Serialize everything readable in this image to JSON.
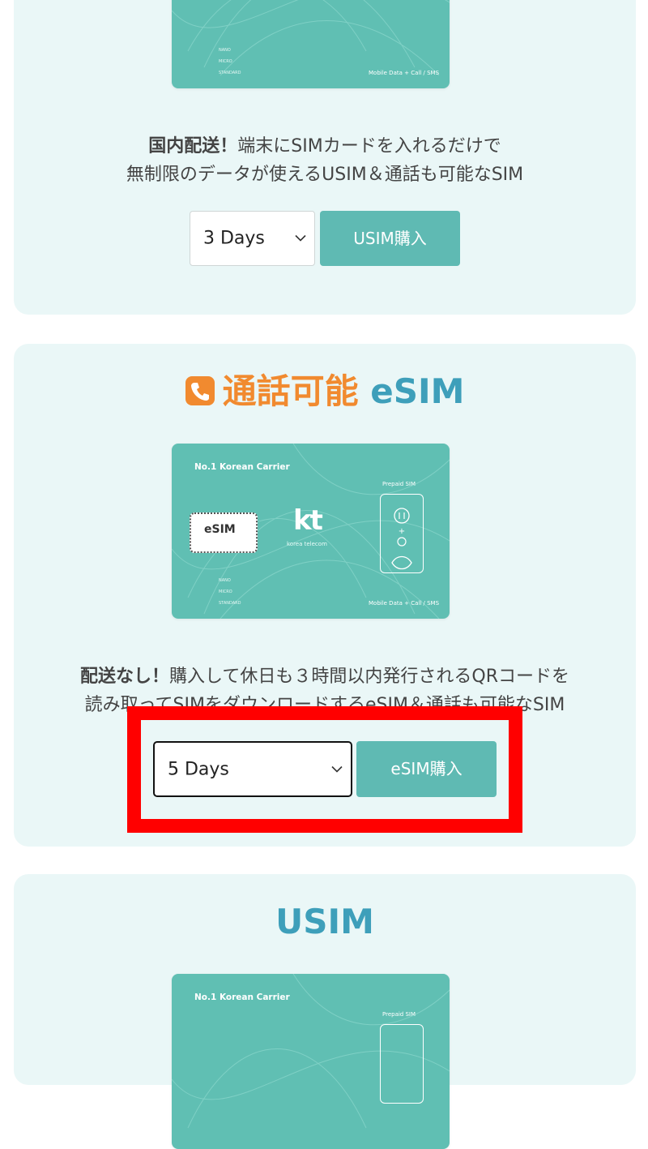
{
  "card": {
    "carrier": "No.1 Korean Carrier",
    "logo": "kt",
    "logo_sub": "korea telecom",
    "prepaid": "Prepaid SIM",
    "footer": "Mobile Data + Call / SMS",
    "sizes": [
      "NANO",
      "MICRO",
      "STANDARD"
    ],
    "esim_chip": "eSIM"
  },
  "usim_section": {
    "desc_bold": "国内配送！",
    "desc_line1": "端末にSIMカードを入れるだけで",
    "desc_line2": "無制限のデータが使えるUSIM＆通話も可能なSIM",
    "select_value": "3 Days",
    "buy_button": "USIM購入"
  },
  "esim_section": {
    "title_orange": "通話可能",
    "title_teal": "eSIM",
    "desc_bold": "配送なし！",
    "desc_line1": "購入して休日も３時間以内発行されるQRコードを",
    "desc_line2": "読み取ってSIMをダウンロードするeSIM＆通話も可能なSIM",
    "select_value": "5 Days",
    "buy_button": "eSIM購入"
  },
  "usim2_section": {
    "title": "USIM"
  },
  "colors": {
    "panel_bg": "#eaf7f7",
    "card_teal": "#60bfb3",
    "button_teal": "#5fbab3",
    "orange": "#f18a2f",
    "title_blue": "#3e9fba",
    "highlight_red": "#ff0000"
  },
  "icons": {
    "phone": "phone-icon",
    "chevron": "chevron-down-icon"
  }
}
